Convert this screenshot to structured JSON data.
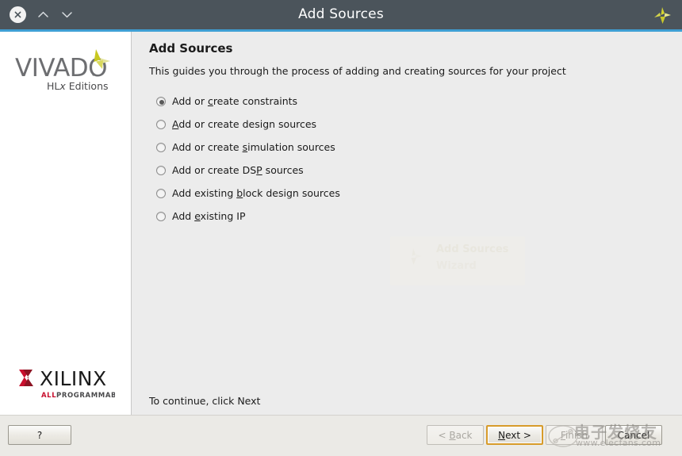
{
  "window": {
    "title": "Add Sources",
    "close_icon": "close-circle-icon",
    "maximize_icon": "chevron-up-icon",
    "minimize_icon": "chevron-down-icon",
    "brand_icon": "xilinx-pinwheel-icon",
    "titlebar_color": "#4b545b",
    "accent_color": "#3f9fd4"
  },
  "sidepanel": {
    "product_name": "VIVADO",
    "product_edition": "HLx Editions",
    "vendor_name": "XILINX",
    "vendor_tagline": "ALL PROGRAMMABLE.",
    "vendor_accent_color": "#c8102e"
  },
  "content": {
    "heading": "Add Sources",
    "description": "This guides you through the process of adding and creating sources for your project",
    "footer_hint": "To continue, click Next",
    "options": [
      {
        "label_pre": "Add or ",
        "mnemonic": "c",
        "label_post": "reate constraints",
        "selected": true
      },
      {
        "label_pre": "",
        "mnemonic": "A",
        "label_post": "dd or create design sources",
        "selected": false
      },
      {
        "label_pre": "Add or create ",
        "mnemonic": "s",
        "label_post": "imulation sources",
        "selected": false
      },
      {
        "label_pre": "Add or create DS",
        "mnemonic": "P",
        "label_post": " sources",
        "selected": false
      },
      {
        "label_pre": "Add existing ",
        "mnemonic": "b",
        "label_post": "lock design sources",
        "selected": false
      },
      {
        "label_pre": "Add ",
        "mnemonic": "e",
        "label_post": "xisting IP",
        "selected": false
      }
    ],
    "ghost_artifact": {
      "line1": "Add Sources",
      "line2": "Wizard"
    }
  },
  "buttons": {
    "help": "?",
    "back_pre": "< ",
    "back_mnemonic": "B",
    "back_post": "ack",
    "next_pre": "",
    "next_mnemonic": "N",
    "next_post": "ext >",
    "finish_pre": "",
    "finish_mnemonic": "F",
    "finish_post": "inish",
    "cancel": "Cancel",
    "focus_color": "#d79b2a"
  },
  "watermark": {
    "chinese_text": "电子发烧友",
    "url_text": "www.elecfans.com"
  }
}
